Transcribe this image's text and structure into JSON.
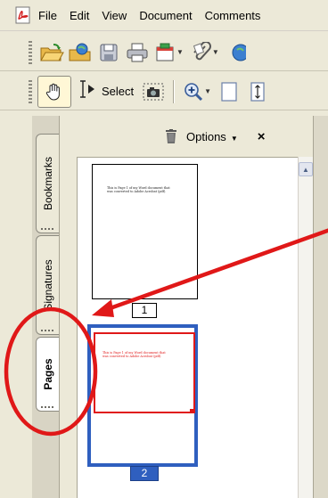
{
  "menu": [
    "File",
    "Edit",
    "View",
    "Document",
    "Comments"
  ],
  "toolbar2": {
    "select_label": "Select"
  },
  "sidebar_tabs": [
    "Bookmarks",
    "Signatures",
    "Pages"
  ],
  "panel": {
    "options_label": "Options",
    "close_label": "×"
  },
  "pages": [
    {
      "number": "1",
      "text": "This is Page 1 of my Word document that was converted to Adobe Acrobat (pdf)."
    },
    {
      "number": "2",
      "text": "This is Page 1 of my Word document that was converted to Adobe Acrobat (pdf)."
    }
  ],
  "icons": {
    "app": "acrobat-icon",
    "open": "open-folder-icon",
    "organizer": "organizer-icon",
    "save": "save-icon",
    "print": "print-icon",
    "create": "create-pdf-icon",
    "attach": "paperclip-icon",
    "email": "email-icon",
    "hand": "hand-tool-icon",
    "select": "select-text-icon",
    "snapshot": "snapshot-icon",
    "zoom": "zoom-in-icon",
    "page": "page-icon",
    "fit": "fit-height-icon",
    "trash": "trash-icon"
  },
  "colors": {
    "annotation": "#e01818",
    "selection": "#2f5fbf"
  }
}
